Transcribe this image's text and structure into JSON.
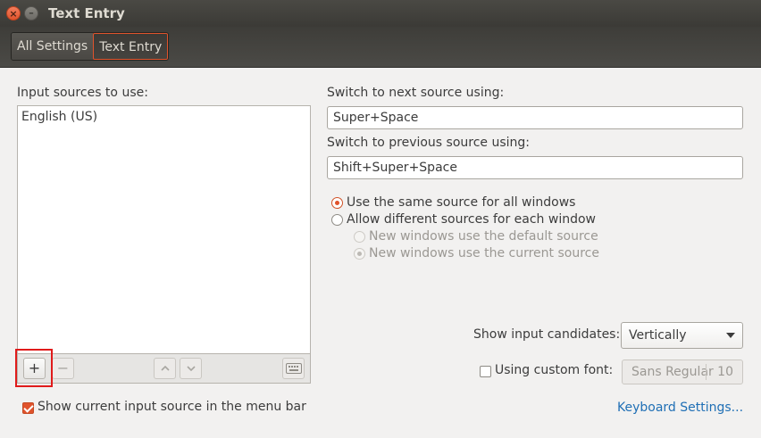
{
  "window": {
    "title": "Text Entry",
    "close_glyph": "×",
    "minimize_glyph": "–"
  },
  "breadcrumb": [
    {
      "label": "All Settings"
    },
    {
      "label": "Text Entry"
    }
  ],
  "input_sources": {
    "label": "Input sources to use:",
    "items": [
      "English (US)"
    ],
    "toolbar": {
      "add": "+",
      "remove": "−",
      "up": "⌃",
      "down": "⌄",
      "keyboard_icon": "keyboard-icon"
    }
  },
  "shortcuts": {
    "next_label": "Switch to next source using:",
    "next_value": "Super+Space",
    "prev_label": "Switch to previous source using:",
    "prev_value": "Shift+Super+Space"
  },
  "source_mode": {
    "same": "Use the same source for all windows",
    "different": "Allow different sources for each window",
    "new_default": "New windows use the default source",
    "new_current": "New windows use the current source"
  },
  "candidates": {
    "label": "Show input candidates:",
    "value": "Vertically"
  },
  "custom_font": {
    "label": "Using custom font:",
    "font_name": "Sans Regular",
    "font_size": "10"
  },
  "menu_bar_option": {
    "label": "Show current input source in the menu bar",
    "checked": true
  },
  "keyboard_settings_link": "Keyboard Settings...",
  "colors": {
    "accent": "#e0532c",
    "titlebar": "#3b3a36",
    "link": "#1f6fb5",
    "highlight_box": "#e01b1b"
  }
}
